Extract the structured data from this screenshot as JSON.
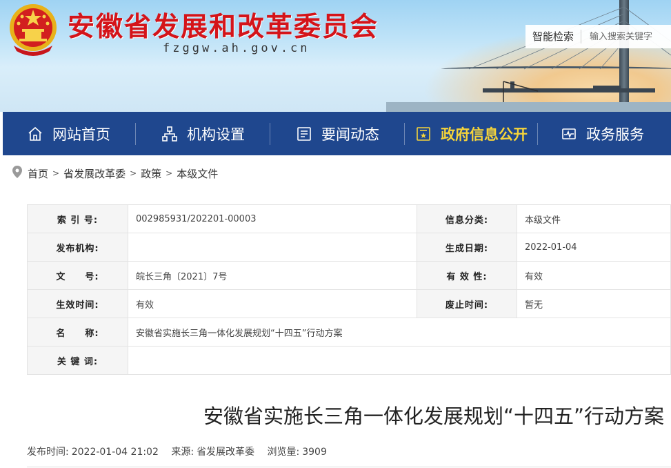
{
  "header": {
    "site_title": "安徽省发展和改革委员会",
    "domain": "fzggw.ah.gov.cn",
    "search_button": "智能检索",
    "search_placeholder": "输入搜索关键字"
  },
  "nav": {
    "items": [
      {
        "label": "网站首页",
        "icon": "home-icon"
      },
      {
        "label": "机构设置",
        "icon": "org-chart-icon"
      },
      {
        "label": "要闻动态",
        "icon": "news-icon"
      },
      {
        "label": "政府信息公开",
        "icon": "gov-info-icon",
        "active": true
      },
      {
        "label": "政务服务",
        "icon": "service-icon"
      }
    ],
    "bg_color": "#1f478e",
    "active_color": "#f6d43a"
  },
  "breadcrumb": [
    "首页",
    "省发展改革委",
    "政策",
    "本级文件"
  ],
  "info": {
    "rows": [
      {
        "k1": "索 引 号:",
        "v1": "002985931/202201-00003",
        "k2": "信息分类:",
        "v2": "本级文件"
      },
      {
        "k1": "发布机构:",
        "v1": "",
        "k2": "生成日期:",
        "v2": "2022-01-04"
      },
      {
        "k1": "文　　号:",
        "v1": "皖长三角〔2021〕7号",
        "k2": "有 效 性:",
        "v2": "有效"
      },
      {
        "k1": "生效时间:",
        "v1": "有效",
        "k2": "废止时间:",
        "v2": "暂无"
      }
    ],
    "name_label": "名　　称:",
    "name_value": "安徽省实施长三角一体化发展规划“十四五”行动方案",
    "keywords_label": "关 键 词:",
    "keywords_value": ""
  },
  "article": {
    "title": "安徽省实施长三角一体化发展规划“十四五”行动方案",
    "publish_label": "发布时间:",
    "publish_time": "2022-01-04 21:02",
    "source_label": "来源:",
    "source": "省发展改革委",
    "views_label": "浏览量:",
    "views": "3909"
  },
  "colors": {
    "title_red": "#d4141a"
  }
}
